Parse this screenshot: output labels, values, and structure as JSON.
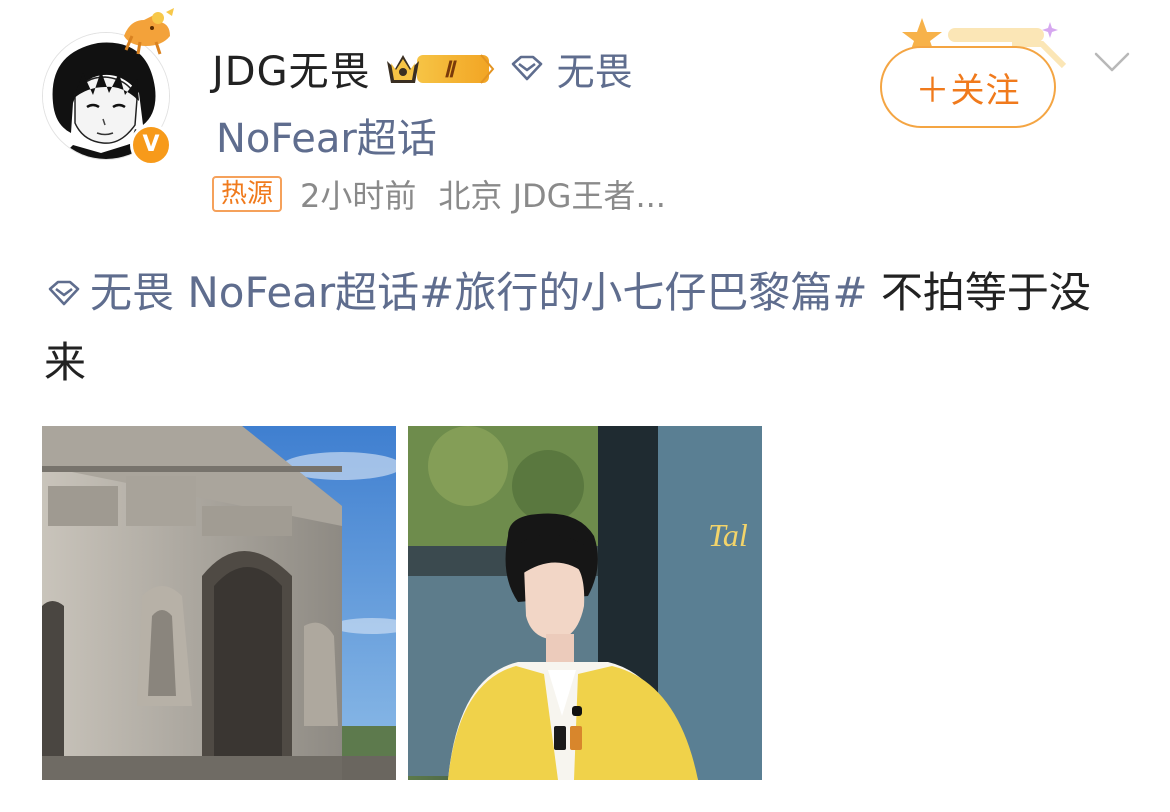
{
  "user": {
    "name": "JDG无畏",
    "avatar_icon": "avatar-image",
    "verified_icon": "verified-v-icon",
    "verified_label": "V",
    "member_level": "Ⅱ"
  },
  "tag": {
    "icon": "diamond-icon",
    "label": "无畏"
  },
  "supertopic_label": "NoFear超话",
  "meta": {
    "hot_badge": "热源",
    "time": "2小时前",
    "location": "北京 JDG王者..."
  },
  "follow_button": {
    "label": "＋关注"
  },
  "more_icon": "chevron-down-icon",
  "post": {
    "topic_link": "无畏 NoFear超话",
    "hashtag": "#旅行的小七仔巴黎篇#",
    "text": " 不拍等于没来"
  },
  "images": [
    {
      "icon": "photo-arc-de-triomphe"
    },
    {
      "icon": "photo-portrait"
    }
  ],
  "colors": {
    "link": "#5f6d8e",
    "accent_orange": "#f07a1c",
    "follow_border": "#f4a543",
    "verified": "#f79a1a",
    "text": "#222222",
    "meta": "#8a8a8a"
  }
}
